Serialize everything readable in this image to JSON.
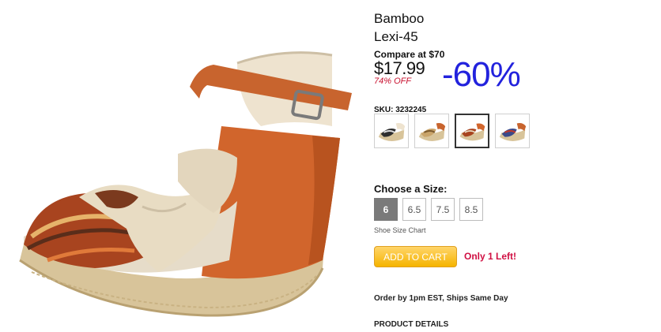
{
  "product": {
    "brand": "Bamboo",
    "model": "Lexi-45",
    "compare_label": "Compare at $70",
    "price": "$17.99",
    "percent_off": "74% OFF",
    "discount_big": "-60%",
    "sku_label": "SKU:",
    "sku_value": "3232245",
    "color_variants": [
      {
        "name": "multi-neutral",
        "selected": false
      },
      {
        "name": "tan-multi",
        "selected": false
      },
      {
        "name": "orange-multi",
        "selected": true
      },
      {
        "name": "blue-multi",
        "selected": false
      }
    ],
    "size_heading": "Choose a Size:",
    "sizes": [
      "6",
      "6.5",
      "7.5",
      "8.5"
    ],
    "selected_size": "6",
    "size_chart_link": "Shoe Size Chart",
    "cart_button": "ADD TO CART",
    "stock_note": "Only 1 Left!",
    "shipping_note": "Order by 1pm EST, Ships Same Day",
    "details_heading": "PRODUCT DETAILS"
  },
  "colors": {
    "discount_blue": "#2222dd",
    "sale_red": "#c8102e",
    "stock_red": "#d01043",
    "cart_yellow": "#f5b400",
    "size_selected_gray": "#7a7a7a"
  }
}
